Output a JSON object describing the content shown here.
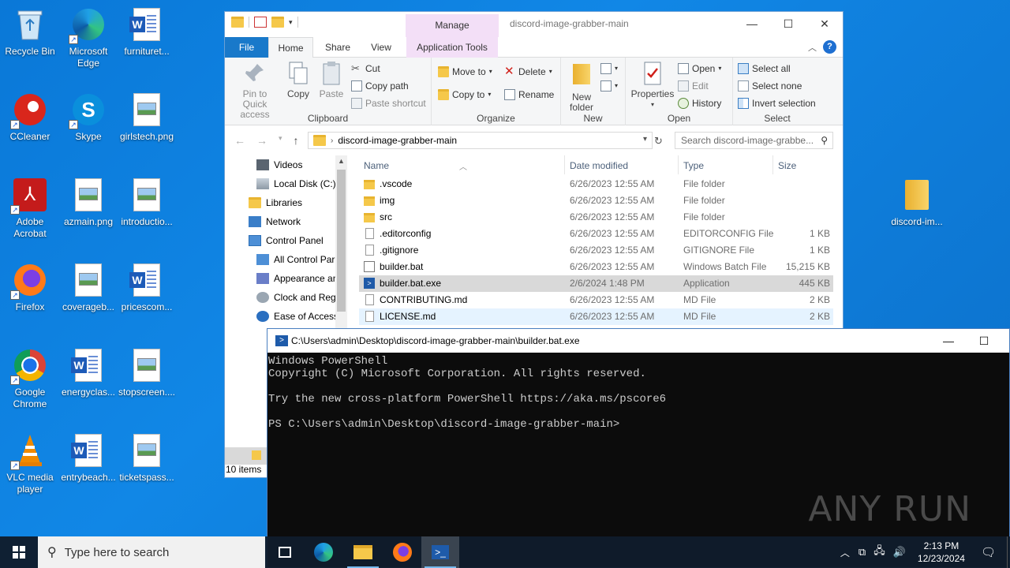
{
  "desktop": {
    "icons": [
      {
        "label": "Recycle Bin"
      },
      {
        "label": "Microsoft Edge"
      },
      {
        "label": "furnituret..."
      },
      {
        "label": "CCleaner"
      },
      {
        "label": "Skype"
      },
      {
        "label": "girlstech.png"
      },
      {
        "label": "Adobe Acrobat"
      },
      {
        "label": "azmain.png"
      },
      {
        "label": "introductio..."
      },
      {
        "label": "Firefox"
      },
      {
        "label": "coverageb..."
      },
      {
        "label": "pricescom..."
      },
      {
        "label": "Google Chrome"
      },
      {
        "label": "energyclas..."
      },
      {
        "label": "stopscreen...."
      },
      {
        "label": "VLC media player"
      },
      {
        "label": "entrybeach..."
      },
      {
        "label": "ticketspass..."
      },
      {
        "label": "discord-im..."
      }
    ]
  },
  "explorer": {
    "title": "discord-image-grabber-main",
    "manage_tab": "Manage",
    "tabs": {
      "file": "File",
      "home": "Home",
      "share": "Share",
      "view": "View",
      "app_tools": "Application Tools"
    },
    "ribbon": {
      "clipboard": {
        "pin": "Pin to Quick access",
        "copy": "Copy",
        "paste": "Paste",
        "cut": "Cut",
        "copy_path": "Copy path",
        "paste_shortcut": "Paste shortcut",
        "label": "Clipboard"
      },
      "organize": {
        "move_to": "Move to",
        "copy_to": "Copy to",
        "delete": "Delete",
        "rename": "Rename",
        "label": "Organize"
      },
      "new": {
        "new_folder": "New folder",
        "label": "New"
      },
      "open": {
        "properties": "Properties",
        "open": "Open",
        "edit": "Edit",
        "history": "History",
        "label": "Open"
      },
      "select": {
        "select_all": "Select all",
        "select_none": "Select none",
        "invert": "Invert selection",
        "label": "Select"
      }
    },
    "address": "discord-image-grabber-main",
    "search_placeholder": "Search discord-image-grabbe...",
    "nav": [
      {
        "label": "Videos"
      },
      {
        "label": "Local Disk (C:)"
      },
      {
        "label": "Libraries"
      },
      {
        "label": "Network"
      },
      {
        "label": "Control Panel"
      },
      {
        "label": "All Control Par"
      },
      {
        "label": "Appearance an"
      },
      {
        "label": "Clock and Regi"
      },
      {
        "label": "Ease of Access"
      }
    ],
    "columns": {
      "name": "Name",
      "date": "Date modified",
      "type": "Type",
      "size": "Size"
    },
    "files": [
      {
        "name": ".vscode",
        "date": "6/26/2023 12:55 AM",
        "type": "File folder",
        "size": ""
      },
      {
        "name": "img",
        "date": "6/26/2023 12:55 AM",
        "type": "File folder",
        "size": ""
      },
      {
        "name": "src",
        "date": "6/26/2023 12:55 AM",
        "type": "File folder",
        "size": ""
      },
      {
        "name": ".editorconfig",
        "date": "6/26/2023 12:55 AM",
        "type": "EDITORCONFIG File",
        "size": "1 KB"
      },
      {
        "name": ".gitignore",
        "date": "6/26/2023 12:55 AM",
        "type": "GITIGNORE File",
        "size": "1 KB"
      },
      {
        "name": "builder.bat",
        "date": "6/26/2023 12:55 AM",
        "type": "Windows Batch File",
        "size": "15,215 KB"
      },
      {
        "name": "builder.bat.exe",
        "date": "2/6/2024 1:48 PM",
        "type": "Application",
        "size": "445 KB"
      },
      {
        "name": "CONTRIBUTING.md",
        "date": "6/26/2023 12:55 AM",
        "type": "MD File",
        "size": "2 KB"
      },
      {
        "name": "LICENSE.md",
        "date": "6/26/2023 12:55 AM",
        "type": "MD File",
        "size": "2 KB"
      }
    ],
    "status": "10 items"
  },
  "powershell": {
    "title": "C:\\Users\\admin\\Desktop\\discord-image-grabber-main\\builder.bat.exe",
    "line1": "Windows PowerShell",
    "line2": "Copyright (C) Microsoft Corporation. All rights reserved.",
    "line3": "Try the new cross-platform PowerShell https://aka.ms/pscore6",
    "prompt": "PS C:\\Users\\admin\\Desktop\\discord-image-grabber-main>"
  },
  "watermark": "ANY RUN",
  "taskbar": {
    "search_placeholder": "Type here to search",
    "time": "2:13 PM",
    "date": "12/23/2024"
  }
}
